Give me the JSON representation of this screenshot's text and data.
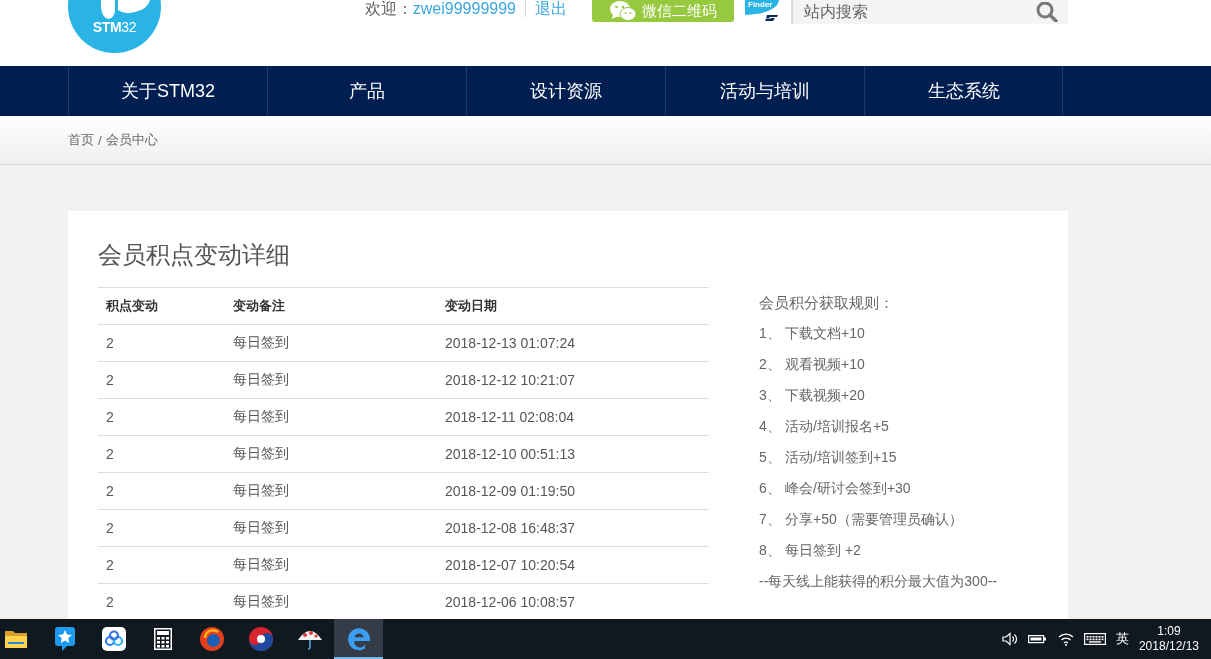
{
  "header": {
    "logo": {
      "text": "**STM**32"
    },
    "welcome": {
      "label": "欢迎：",
      "username": "zwei99999999",
      "logout": "退出"
    },
    "wechat_button": {
      "label": "微信二维码"
    },
    "finder_badge": {
      "text": "Finder"
    },
    "search": {
      "placeholder": "站内搜索"
    }
  },
  "nav": [
    {
      "label": "关于STM32"
    },
    {
      "label": "产品"
    },
    {
      "label": "设计资源"
    },
    {
      "label": "活动与培训"
    },
    {
      "label": "生态系统"
    }
  ],
  "breadcrumb": {
    "items": [
      "首页",
      "会员中心"
    ],
    "separator": "/"
  },
  "points_card": {
    "title": "会员积点变动详细",
    "table": {
      "columns": [
        "积点变动",
        "变动备注",
        "变动日期"
      ],
      "rows": [
        [
          "2",
          "每日签到",
          "2018-12-13 01:07:24"
        ],
        [
          "2",
          "每日签到",
          "2018-12-12 10:21:07"
        ],
        [
          "2",
          "每日签到",
          "2018-12-11 02:08:04"
        ],
        [
          "2",
          "每日签到",
          "2018-12-10 00:51:13"
        ],
        [
          "2",
          "每日签到",
          "2018-12-09 01:19:50"
        ],
        [
          "2",
          "每日签到",
          "2018-12-08 16:48:37"
        ],
        [
          "2",
          "每日签到",
          "2018-12-07 10:20:54"
        ],
        [
          "2",
          "每日签到",
          "2018-12-06 10:08:57"
        ]
      ]
    },
    "rules": {
      "title": "会员积分获取规则：",
      "items": [
        {
          "number": "1、",
          "text": "下载文档+10"
        },
        {
          "number": "2、",
          "text": "观看视频+10"
        },
        {
          "number": "3、",
          "text": "下载视频+20"
        },
        {
          "number": "4、",
          "text": "活动/培训报名+5"
        },
        {
          "number": "5、",
          "text": "活动/培训签到+15"
        },
        {
          "number": "6、",
          "text": "峰会/研讨会签到+30"
        },
        {
          "number": "7、",
          "text": "分享+50（需要管理员确认）"
        },
        {
          "number": "8、",
          "text": "每日签到 +2"
        }
      ],
      "note": "--每天线上能获得的积分最大值为300--"
    }
  },
  "taskbar": {
    "apps": [
      {
        "kind": "folder",
        "selected": false
      },
      {
        "kind": "star",
        "selected": false
      },
      {
        "kind": "rings",
        "selected": false
      },
      {
        "kind": "calculator",
        "selected": false
      },
      {
        "kind": "orb",
        "selected": false
      },
      {
        "kind": "swirl",
        "selected": false
      },
      {
        "kind": "umbrella",
        "selected": false
      },
      {
        "kind": "e-logo",
        "selected": true
      }
    ],
    "tray": {
      "input_language": "英",
      "time": "1:09",
      "date": "2018/12/13"
    }
  }
}
